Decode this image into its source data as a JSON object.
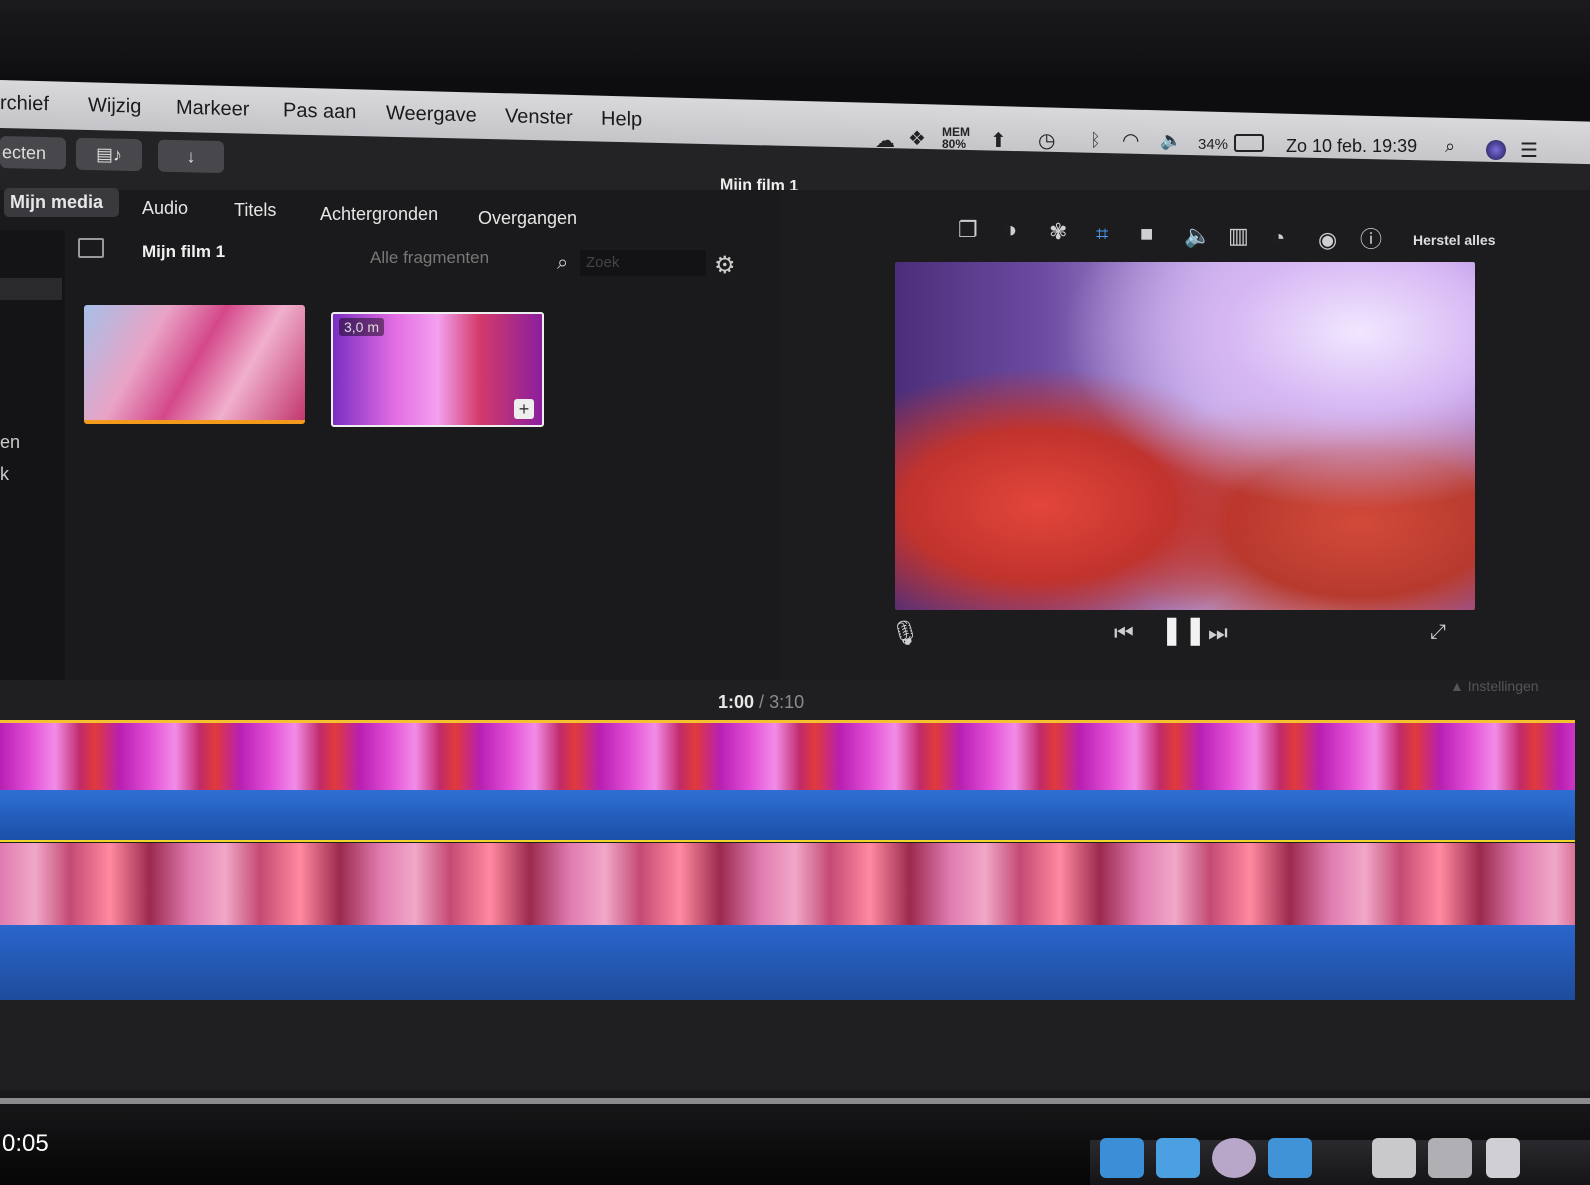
{
  "menubar": {
    "items": [
      "rchief",
      "Wijzig",
      "Markeer",
      "Pas aan",
      "Weergave",
      "Venster",
      "Help"
    ],
    "status": {
      "mem": "MEM 80%",
      "battery": "34%",
      "datetime": "Zo 10 feb.  19:39"
    }
  },
  "toolbar": {
    "projects_label": "ecten",
    "window_title": "Mijn film 1",
    "reset_label": "Herstel alles"
  },
  "browser": {
    "tabs": [
      "Mijn media",
      "Audio",
      "Titels",
      "Achtergronden",
      "Overgangen"
    ],
    "library_title": "Mijn film 1",
    "filter_label": "Alle fragmenten",
    "search_placeholder": "Zoek",
    "clip_duration_badge": "3,0 m",
    "sidebar_fragments": [
      "en",
      "k"
    ]
  },
  "timeline": {
    "current": "1:00",
    "separator": "/",
    "total": "3:10",
    "settings_label": "Instellingen"
  },
  "video_overlay": {
    "elapsed": "0:05"
  },
  "colors": {
    "accent_clip_border": "#f3c22e",
    "selected_tab_bg": "#3a3a3e",
    "audio_wave": "#2f6fd3"
  },
  "icons": [
    "cloud-icon",
    "dropbox-icon",
    "upload-icon",
    "time-machine-icon",
    "bluetooth-icon",
    "wifi-icon",
    "volume-icon",
    "battery-icon",
    "spotlight-icon",
    "siri-icon",
    "notification-icon",
    "magic-wand-icon",
    "overlay-icon",
    "color-balance-icon",
    "color-correction-icon",
    "crop-icon",
    "stabilization-icon",
    "volume-adjust-icon",
    "equalizer-icon",
    "speed-icon",
    "noise-reduction-icon",
    "info-icon",
    "microphone-icon",
    "skip-back-icon",
    "pause-icon",
    "skip-forward-icon",
    "fullscreen-icon",
    "gear-icon",
    "search-icon",
    "sidebar-toggle-icon"
  ]
}
